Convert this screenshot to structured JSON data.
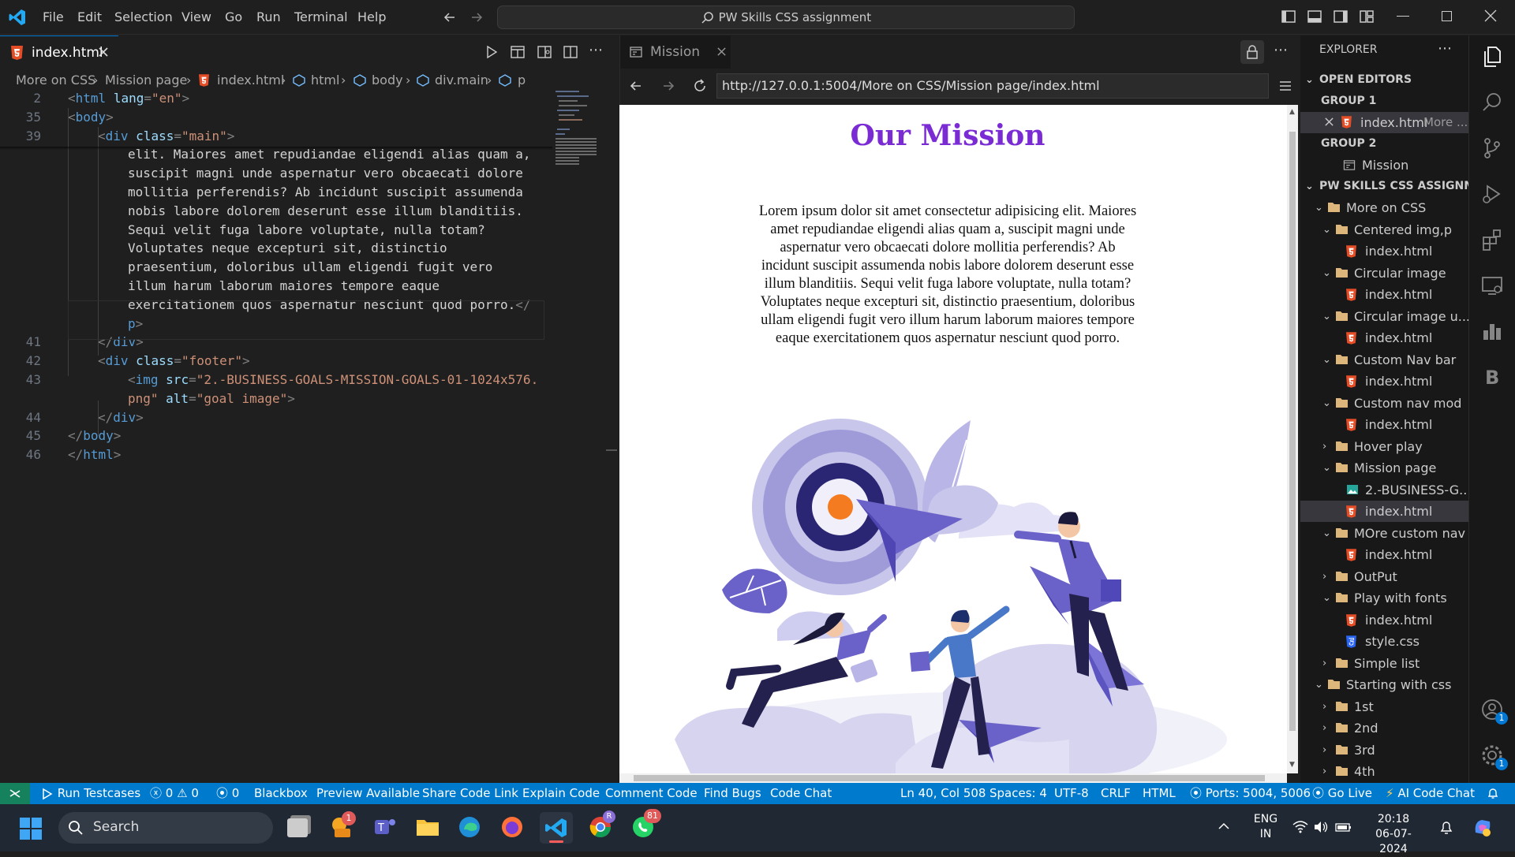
{
  "window": {
    "title": "PW Skills CSS assignment",
    "menu": [
      "File",
      "Edit",
      "Selection",
      "View",
      "Go",
      "Run",
      "Terminal",
      "Help"
    ]
  },
  "editor": {
    "tab_label": "index.html",
    "breadcrumb": [
      "More on CSS",
      "Mission page",
      "index.html",
      "html",
      "body",
      "div.main",
      "p"
    ],
    "lines": [
      {
        "n": "2",
        "segs": [
          [
            "pu",
            "<"
          ],
          [
            "tg",
            "html "
          ],
          [
            "at",
            "lang"
          ],
          [
            "pu",
            "="
          ],
          [
            "st",
            "\"en\""
          ],
          [
            "pu",
            ">"
          ]
        ],
        "indent": 0
      },
      {
        "n": "35",
        "segs": [
          [
            "pu",
            "<"
          ],
          [
            "tg",
            "body"
          ],
          [
            "pu",
            ">"
          ]
        ],
        "indent": 0
      },
      {
        "n": "39",
        "segs": [
          [
            "pu",
            "<"
          ],
          [
            "tg",
            "div "
          ],
          [
            "at",
            "class"
          ],
          [
            "pu",
            "="
          ],
          [
            "st",
            "\"main\""
          ],
          [
            "pu",
            ">"
          ]
        ],
        "indent": 1
      },
      {
        "n": "",
        "segs": [
          [
            "tx",
            "elit. Maiores amet repudiandae eligendi alias quam a,"
          ]
        ],
        "indent": 2
      },
      {
        "n": "",
        "segs": [
          [
            "tx",
            "suscipit magni unde aspernatur vero obcaecati dolore"
          ]
        ],
        "indent": 2
      },
      {
        "n": "",
        "segs": [
          [
            "tx",
            "mollitia perferendis? Ab incidunt suscipit assumenda"
          ]
        ],
        "indent": 2
      },
      {
        "n": "",
        "segs": [
          [
            "tx",
            "nobis labore dolorem deserunt esse illum blanditiis."
          ]
        ],
        "indent": 2
      },
      {
        "n": "",
        "segs": [
          [
            "tx",
            "Sequi velit fuga labore voluptate, nulla totam?"
          ]
        ],
        "indent": 2
      },
      {
        "n": "",
        "segs": [
          [
            "tx",
            "Voluptates neque excepturi sit, distinctio"
          ]
        ],
        "indent": 2
      },
      {
        "n": "",
        "segs": [
          [
            "tx",
            "praesentium, doloribus ullam eligendi fugit vero"
          ]
        ],
        "indent": 2
      },
      {
        "n": "",
        "segs": [
          [
            "tx",
            "illum harum laborum maiores tempore eaque"
          ]
        ],
        "indent": 2
      },
      {
        "n": "",
        "segs": [
          [
            "tx",
            "exercitationem quos aspernatur nesciunt quod porro."
          ],
          [
            "pu",
            "</"
          ]
        ],
        "indent": 2
      },
      {
        "n": "",
        "segs": [
          [
            "tg",
            "p"
          ],
          [
            "pu",
            ">"
          ]
        ],
        "indent": 2
      },
      {
        "n": "41",
        "segs": [
          [
            "pu",
            "</"
          ],
          [
            "tg",
            "div"
          ],
          [
            "pu",
            ">"
          ]
        ],
        "indent": 1
      },
      {
        "n": "42",
        "segs": [
          [
            "pu",
            "<"
          ],
          [
            "tg",
            "div "
          ],
          [
            "at",
            "class"
          ],
          [
            "pu",
            "="
          ],
          [
            "st",
            "\"footer\""
          ],
          [
            "pu",
            ">"
          ]
        ],
        "indent": 1
      },
      {
        "n": "43",
        "segs": [
          [
            "pu",
            "<"
          ],
          [
            "tg",
            "img "
          ],
          [
            "at",
            "src"
          ],
          [
            "pu",
            "="
          ],
          [
            "st",
            "\"2.-BUSINESS-GOALS-MISSION-GOALS-01-1024x576."
          ]
        ],
        "indent": 2
      },
      {
        "n": "",
        "segs": [
          [
            "st",
            "png\""
          ],
          [
            "at",
            " alt"
          ],
          [
            "pu",
            "="
          ],
          [
            "st",
            "\"goal image\""
          ],
          [
            "pu",
            ">"
          ]
        ],
        "indent": 2
      },
      {
        "n": "44",
        "segs": [
          [
            "pu",
            "</"
          ],
          [
            "tg",
            "div"
          ],
          [
            "pu",
            ">"
          ]
        ],
        "indent": 1
      },
      {
        "n": "45",
        "segs": [
          [
            "pu",
            "</"
          ],
          [
            "tg",
            "body"
          ],
          [
            "pu",
            ">"
          ]
        ],
        "indent": 0
      },
      {
        "n": "46",
        "segs": [
          [
            "pu",
            "</"
          ],
          [
            "tg",
            "html"
          ],
          [
            "pu",
            ">"
          ]
        ],
        "indent": 0
      }
    ]
  },
  "preview": {
    "tab_label": "Mission",
    "url": "http://127.0.0.1:5004/More on CSS/Mission page/index.html",
    "heading": "Our Mission",
    "paragraph_lines": [
      "Lorem ipsum dolor sit amet consectetur adipisicing elit. Maiores",
      "amet repudiandae eligendi alias quam a, suscipit magni unde",
      "aspernatur vero obcaecati dolore mollitia perferendis? Ab",
      "incidunt suscipit assumenda nobis labore dolorem deserunt esse",
      "illum blanditiis. Sequi velit fuga labore voluptate, nulla totam?",
      "Voluptates neque excepturi sit, distinctio praesentium, doloribus",
      "ullam eligendi fugit vero illum harum laborum maiores tempore",
      "eaque exercitationem quos aspernatur nesciunt quod porro."
    ],
    "heading_color": "#7a2bd4"
  },
  "sidebar": {
    "header": "EXPLORER",
    "open_editors": "OPEN EDITORS",
    "group1": "GROUP 1",
    "group1_file": "index.html",
    "group1_desc": "More ...",
    "group2": "GROUP 2",
    "group2_item": "Mission",
    "project": "PW SKILLS CSS ASSIGNME...",
    "tree": [
      {
        "label": "More on CSS",
        "type": "folder",
        "level": 1,
        "open": true
      },
      {
        "label": "Centered img,p",
        "type": "folder",
        "level": 2,
        "open": true
      },
      {
        "label": "index.html",
        "type": "html",
        "level": 3
      },
      {
        "label": "Circular image",
        "type": "folder",
        "level": 2,
        "open": true
      },
      {
        "label": "index.html",
        "type": "html",
        "level": 3
      },
      {
        "label": "Circular image u...",
        "type": "folder",
        "level": 2,
        "open": true
      },
      {
        "label": "index.html",
        "type": "html",
        "level": 3
      },
      {
        "label": "Custom Nav bar",
        "type": "folder",
        "level": 2,
        "open": true
      },
      {
        "label": "index.html",
        "type": "html",
        "level": 3
      },
      {
        "label": "Custom nav mod",
        "type": "folder",
        "level": 2,
        "open": true
      },
      {
        "label": "index.html",
        "type": "html",
        "level": 3
      },
      {
        "label": "Hover play",
        "type": "folder",
        "level": 2,
        "open": false
      },
      {
        "label": "Mission page",
        "type": "folder",
        "level": 2,
        "open": true
      },
      {
        "label": "2.-BUSINESS-G...",
        "type": "image",
        "level": 3
      },
      {
        "label": "index.html",
        "type": "html",
        "level": 3,
        "selected": true
      },
      {
        "label": "MOre custom nav",
        "type": "folder",
        "level": 2,
        "open": true
      },
      {
        "label": "index.html",
        "type": "html",
        "level": 3
      },
      {
        "label": "OutPut",
        "type": "folder",
        "level": 2,
        "open": false
      },
      {
        "label": "Play with fonts",
        "type": "folder",
        "level": 2,
        "open": true
      },
      {
        "label": "index.html",
        "type": "html",
        "level": 3
      },
      {
        "label": "style.css",
        "type": "css",
        "level": 3
      },
      {
        "label": "Simple list",
        "type": "folder",
        "level": 2,
        "open": false
      },
      {
        "label": "Starting with css",
        "type": "folder",
        "level": 1,
        "open": true
      },
      {
        "label": "1st",
        "type": "folder",
        "level": 2,
        "open": false
      },
      {
        "label": "2nd",
        "type": "folder",
        "level": 2,
        "open": false
      },
      {
        "label": "3rd",
        "type": "folder",
        "level": 2,
        "open": false
      },
      {
        "label": "4th",
        "type": "folder",
        "level": 2,
        "open": false
      }
    ]
  },
  "statusbar": {
    "run_testcases": "Run Testcases",
    "errors": "0",
    "warnings": "0",
    "ports_count": "0",
    "blackbox": "Blackbox",
    "preview": "Preview Available",
    "share": "Share Code Link",
    "explain": "Explain Code",
    "comment": "Comment Code",
    "bugs": "Find Bugs",
    "chat": "Code Chat",
    "position": "Ln 40, Col 508",
    "spaces": "Spaces: 4",
    "encoding": "UTF-8",
    "eol": "CRLF",
    "language": "HTML",
    "ports": "Ports: 5004, 5006",
    "golive": "Go Live",
    "aichat": "AI Code Chat"
  },
  "taskbar": {
    "search": "Search",
    "lang1": "ENG",
    "lang2": "IN",
    "time": "20:18",
    "date": "06-07-2024",
    "badge_chrome": "R",
    "badge_whatsapp": "81",
    "badge_app": "1"
  },
  "activity": {
    "accounts_badge": "1",
    "settings_badge": "1"
  }
}
